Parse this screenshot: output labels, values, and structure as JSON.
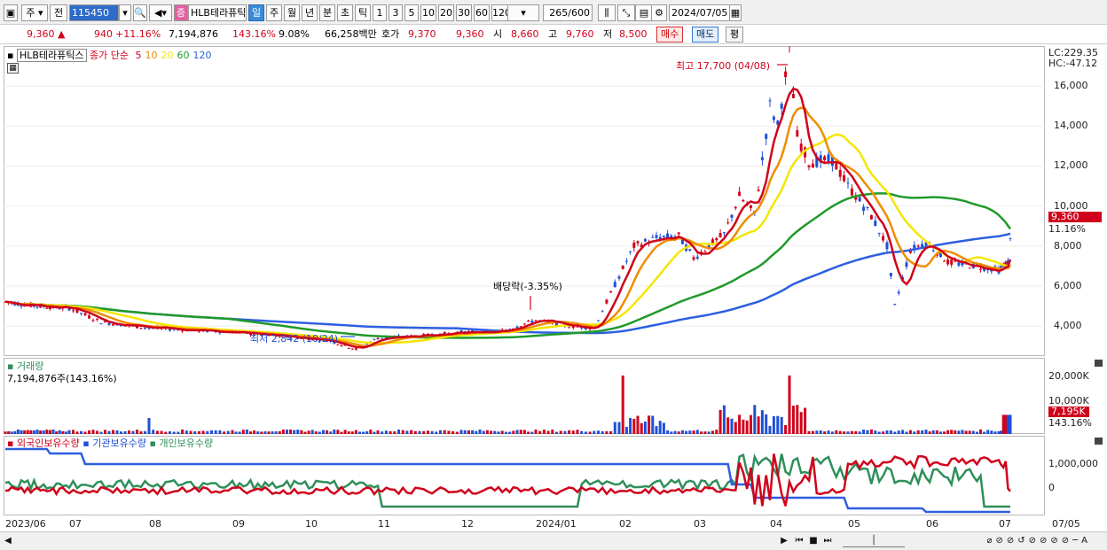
{
  "toolbar": {
    "type_label": "주",
    "prev_label": "전",
    "code_value": "115450",
    "stock_name": "HLB테라퓨틱",
    "period_tabs": [
      "일",
      "주",
      "월",
      "년",
      "분",
      "초",
      "틱"
    ],
    "active_period": "일",
    "minute_options": [
      "1",
      "3",
      "5",
      "10",
      "20",
      "30",
      "60",
      "120"
    ],
    "count_value": "265",
    "count_total": "/600",
    "date_value": "2024/07/05"
  },
  "quote": {
    "price": "9,360",
    "change": "940",
    "change_pct": "+11.16%",
    "volume": "7,194,876",
    "volume_ratio": "143.16%",
    "turnover": "9.08%",
    "amount": "66,258백만",
    "ask_label": "호가",
    "ask": "9,370",
    "bid": "9,360",
    "open_label": "시",
    "open": "8,660",
    "high_label": "고",
    "high": "9,760",
    "low_label": "저",
    "low": "8,500",
    "buy_label": "매수",
    "sell_label": "매도",
    "eval_label": "평"
  },
  "price_panel": {
    "stock_tag": "HLB테라퓨틱스",
    "ma_title": "종가 단순",
    "ma_periods": [
      "5",
      "10",
      "20",
      "60",
      "120"
    ],
    "lc": "LC:229.35",
    "hc": "HC:-47.12",
    "y_ticks": [
      "16,000",
      "14,000",
      "12,000",
      "10,000",
      "8,000",
      "6,000",
      "4,000"
    ],
    "price_tag": "9,360",
    "pct_tag": "11.16%",
    "high_note": "최고 17,700 (04/08)",
    "low_note": "최저 2,842 (10/24)",
    "dividend_note": "배당락(-3.35%)"
  },
  "volume_panel": {
    "title": "거래량",
    "value": "7,194,876주(143.16%)",
    "y_ticks": [
      "20,000K",
      "10,000K"
    ],
    "vol_tag": "7,195K",
    "vol_pct": "143.16%"
  },
  "holdings_panel": {
    "series": [
      "외국인보유수량",
      "기관보유수량",
      "개인보유수량"
    ],
    "y_ticks": [
      "1,000,000",
      "0"
    ]
  },
  "x_axis": [
    "2023/06",
    "07",
    "08",
    "09",
    "10",
    "11",
    "12",
    "2024/01",
    "02",
    "03",
    "04",
    "05",
    "06",
    "07",
    "07/05"
  ],
  "colors": {
    "up": "#d0021b",
    "down": "#1e4fd8",
    "ma5": "#d0021b",
    "ma10": "#f08c00",
    "ma20": "#f5e600",
    "ma60": "#1f9a2a",
    "ma120": "#2d5fe0",
    "foreign": "#d0021b",
    "institution": "#2d5fe0",
    "individual": "#2f8f5a"
  },
  "chart_data": {
    "type": "line",
    "title": "HLB테라퓨틱스",
    "series": [
      {
        "name": "종가",
        "points": [
          [
            "2023/06",
            5200
          ],
          [
            "2023/07",
            4800
          ],
          [
            "2023/08",
            3900
          ],
          [
            "2023/09",
            3700
          ],
          [
            "2023/10",
            3300
          ],
          [
            "2023/10/24",
            2842
          ],
          [
            "2023/11",
            3500
          ],
          [
            "2023/12",
            3800
          ],
          [
            "2024/01",
            4300
          ],
          [
            "2024/02",
            8000
          ],
          [
            "2024/03",
            8500
          ],
          [
            "2024/03/20",
            10500
          ],
          [
            "2024/04/08",
            17700
          ],
          [
            "2024/04/15",
            12500
          ],
          [
            "2024/05",
            10000
          ],
          [
            "2024/05/20",
            5000
          ],
          [
            "2024/06",
            7500
          ],
          [
            "2024/07",
            7000
          ],
          [
            "2024/07/05",
            9360
          ]
        ]
      }
    ],
    "y_range": [
      2500,
      18000
    ]
  }
}
